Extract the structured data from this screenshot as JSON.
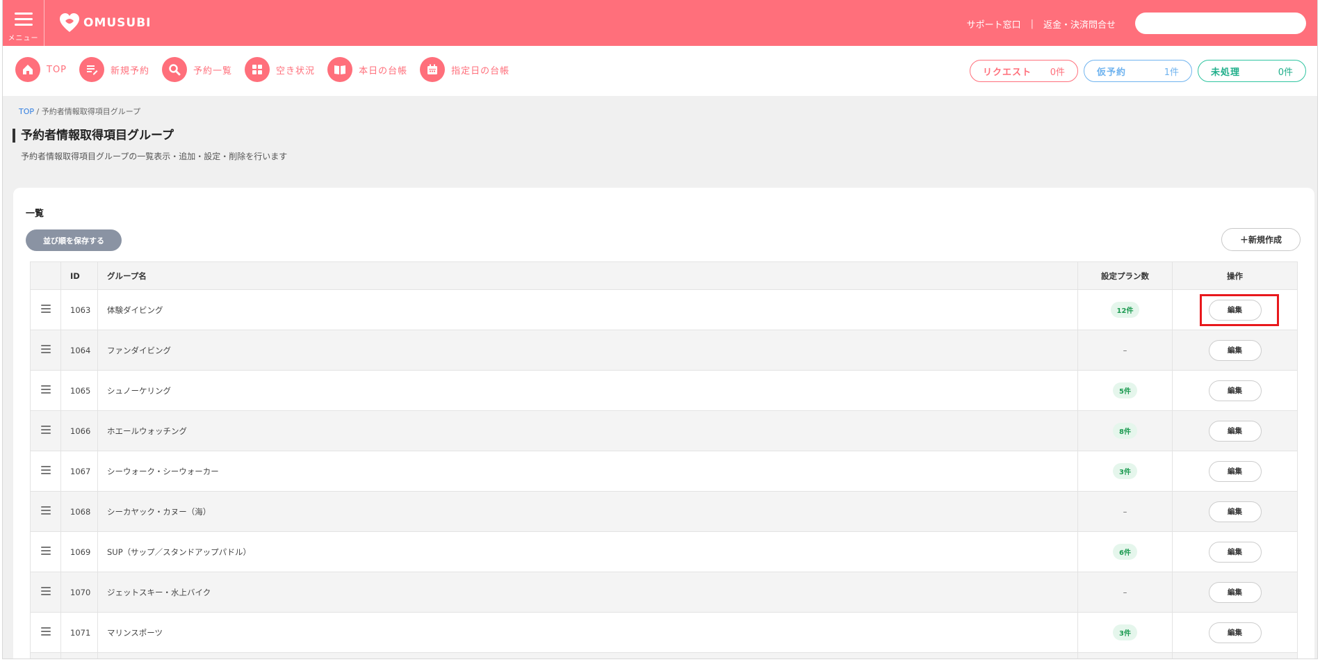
{
  "header": {
    "menu_label": "メニュー",
    "logo_text": "OMUSUBI",
    "support_link": "サポート窓口",
    "separator": "|",
    "refund_link": "返金・決済問合せ",
    "search_placeholder": ""
  },
  "nav": {
    "items": [
      {
        "label": "TOP",
        "icon": "home-icon"
      },
      {
        "label": "新規予約",
        "icon": "new-reservation-icon"
      },
      {
        "label": "予約一覧",
        "icon": "search-icon"
      },
      {
        "label": "空き状況",
        "icon": "grid-icon"
      },
      {
        "label": "本日の台帳",
        "icon": "book-icon"
      },
      {
        "label": "指定日の台帳",
        "icon": "calendar-icon"
      }
    ],
    "status": [
      {
        "label": "リクエスト",
        "count": "0件"
      },
      {
        "label": "仮予約",
        "count": "1件"
      },
      {
        "label": "未処理",
        "count": "0件"
      }
    ]
  },
  "breadcrumb": {
    "home": "TOP",
    "sep": "/",
    "current": "予約者情報取得項目グループ"
  },
  "page": {
    "title": "予約者情報取得項目グループ",
    "description": "予約者情報取得項目グループの一覧表示・追加・設定・削除を行います"
  },
  "list": {
    "title": "一覧",
    "save_order": "並び順を保存する",
    "new_button": "＋新規作成",
    "columns": {
      "id": "ID",
      "group": "グループ名",
      "plans": "設定プラン数",
      "ops": "操作"
    },
    "edit_label": "編集",
    "rows": [
      {
        "id": "1063",
        "name": "体験ダイビング",
        "plans": "12件"
      },
      {
        "id": "1064",
        "name": "ファンダイビング",
        "plans": "–"
      },
      {
        "id": "1065",
        "name": "シュノーケリング",
        "plans": "5件"
      },
      {
        "id": "1066",
        "name": "ホエールウォッチング",
        "plans": "8件"
      },
      {
        "id": "1067",
        "name": "シーウォーク・シーウォーカー",
        "plans": "3件"
      },
      {
        "id": "1068",
        "name": "シーカヤック・カヌー（海）",
        "plans": "–"
      },
      {
        "id": "1069",
        "name": "SUP（サップ／スタンドアップパドル）",
        "plans": "6件"
      },
      {
        "id": "1070",
        "name": "ジェットスキー・水上バイク",
        "plans": "–"
      },
      {
        "id": "1071",
        "name": "マリンスポーツ",
        "plans": "3件"
      },
      {
        "id": "",
        "name": "",
        "plans": ""
      }
    ]
  },
  "colors": {
    "brand": "#ff6f7b",
    "link": "#2f7de0",
    "badge_green": "#1e9b52",
    "highlight": "#e8181c"
  }
}
